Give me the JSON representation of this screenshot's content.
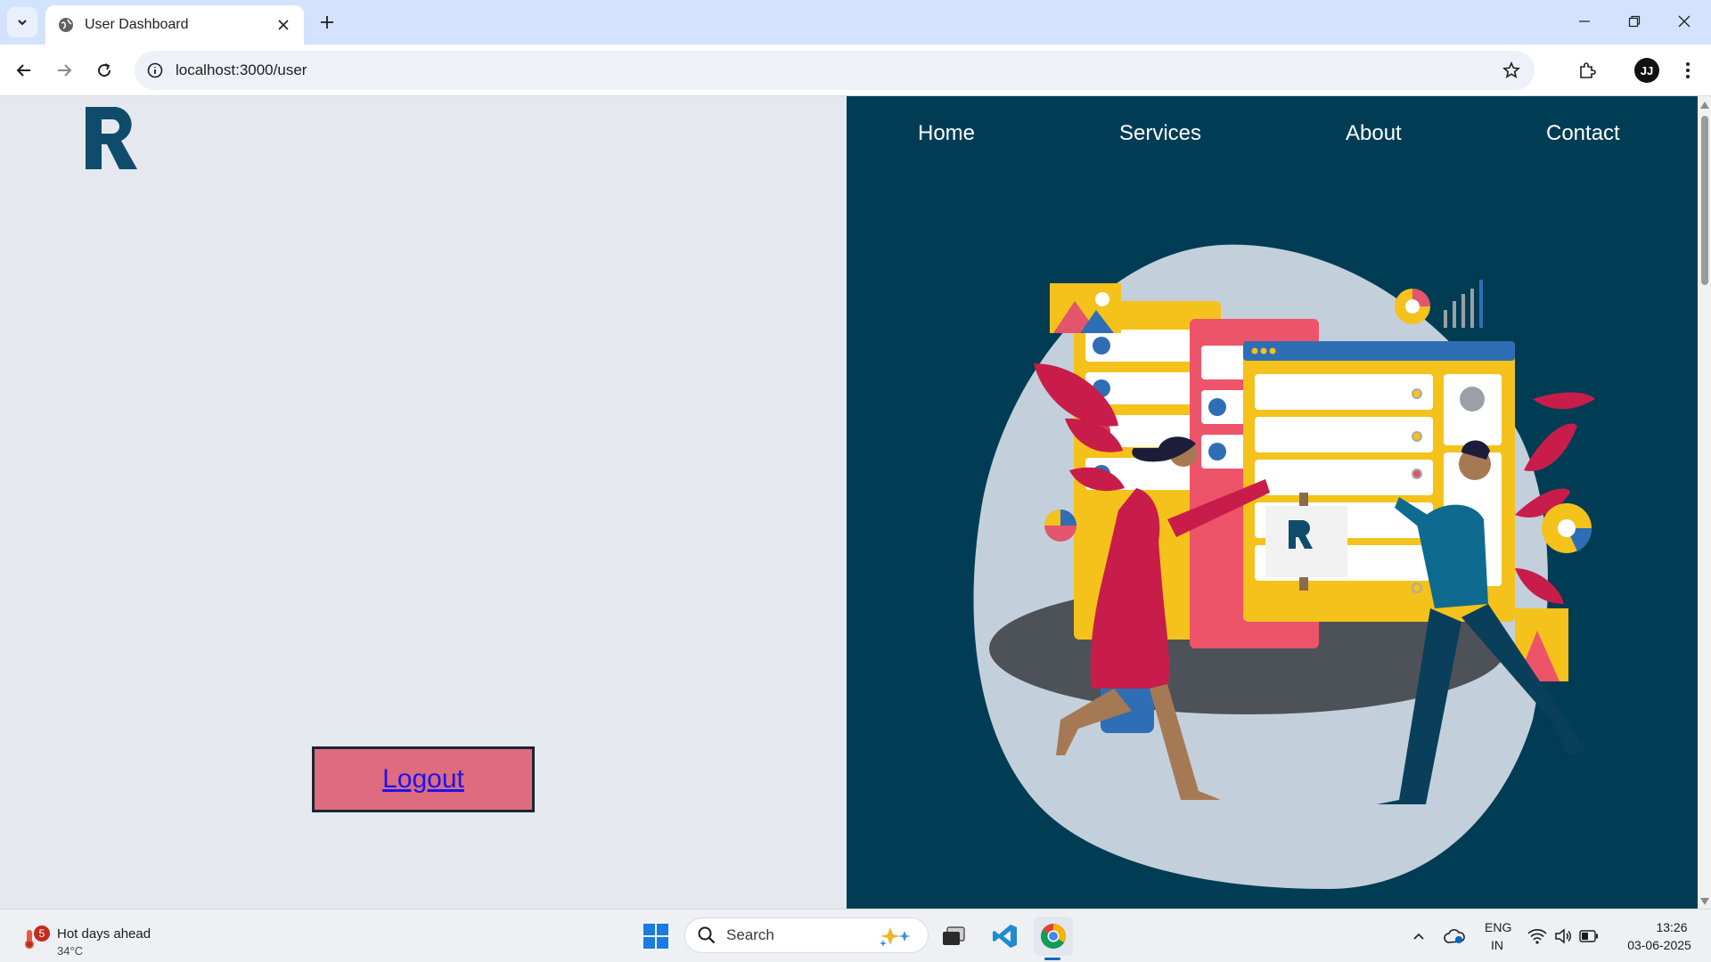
{
  "browser": {
    "tab_title": "User Dashboard",
    "url": "localhost:3000/user",
    "profile_initials": "JJ"
  },
  "page": {
    "logout_label": "Logout",
    "nav": [
      {
        "label": "Home"
      },
      {
        "label": "Services"
      },
      {
        "label": "About"
      },
      {
        "label": "Contact"
      }
    ],
    "colors": {
      "left_bg": "#e5e9ef",
      "right_bg": "#003d55",
      "logo": "#0f4c6b",
      "logout_bg": "#df6b7e",
      "logout_link": "#1b14ee"
    }
  },
  "taskbar": {
    "weather_badge": "5",
    "weather_title": "Hot days ahead",
    "weather_temp": "34°C",
    "search_label": "Search",
    "lang_top": "ENG",
    "lang_bottom": "IN",
    "time": "13:26",
    "date": "03-06-2025"
  }
}
